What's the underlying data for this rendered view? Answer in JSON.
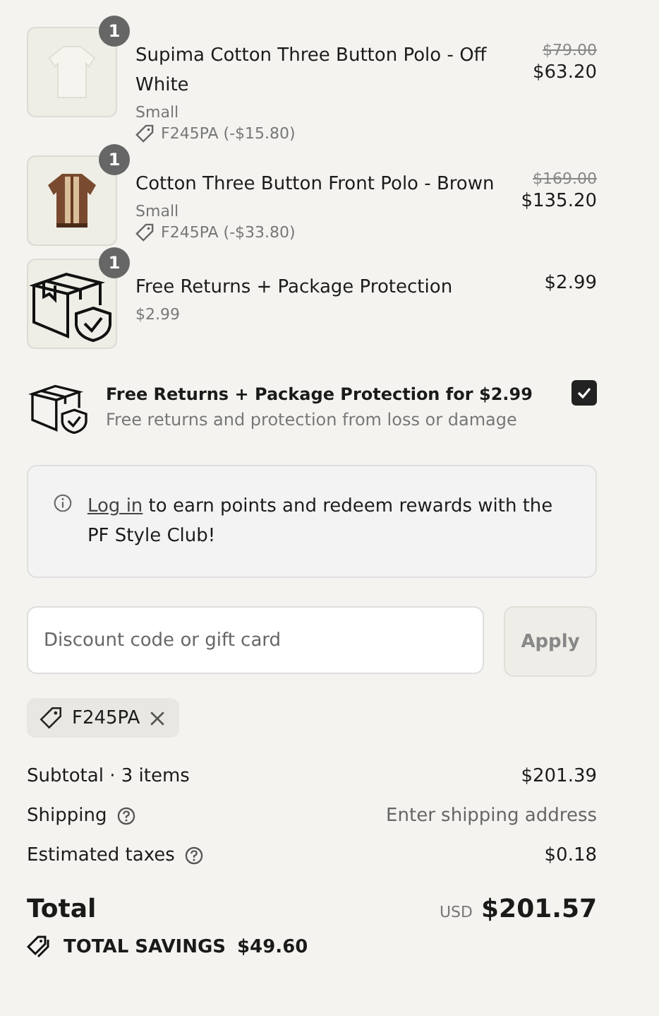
{
  "line_items": [
    {
      "quantity": "1",
      "title": "Supima Cotton Three Button Polo - Off White",
      "variant": "Small",
      "discount": "F245PA (-$15.80)",
      "compare_price": "$79.00",
      "price": "$63.20"
    },
    {
      "quantity": "1",
      "title": "Cotton Three Button Front Polo - Brown",
      "variant": "Small",
      "discount": "F245PA (-$33.80)",
      "compare_price": "$169.00",
      "price": "$135.20"
    },
    {
      "quantity": "1",
      "title": "Free Returns + Package Protection",
      "variant": "$2.99",
      "price": "$2.99"
    }
  ],
  "protection": {
    "title": "Free Returns + Package Protection for $2.99",
    "description": "Free returns and protection from loss or damage",
    "checked": true
  },
  "login_notice": {
    "link": "Log in",
    "text": "to earn points and redeem rewards with the PF Style Club!"
  },
  "discount_field": {
    "placeholder": "Discount code or gift card",
    "button": "Apply"
  },
  "applied_codes": [
    "F245PA"
  ],
  "summary": [
    {
      "label": "Subtotal · 3 items",
      "help": false,
      "value": "$201.39",
      "muted": false
    },
    {
      "label": "Shipping",
      "help": true,
      "value": "Enter shipping address",
      "muted": true
    },
    {
      "label": "Estimated taxes",
      "help": true,
      "value": "$0.18",
      "muted": false
    }
  ],
  "total": {
    "label": "Total",
    "currency": "USD",
    "amount": "$201.57"
  },
  "savings": {
    "label": "TOTAL SAVINGS",
    "amount": "$49.60"
  }
}
